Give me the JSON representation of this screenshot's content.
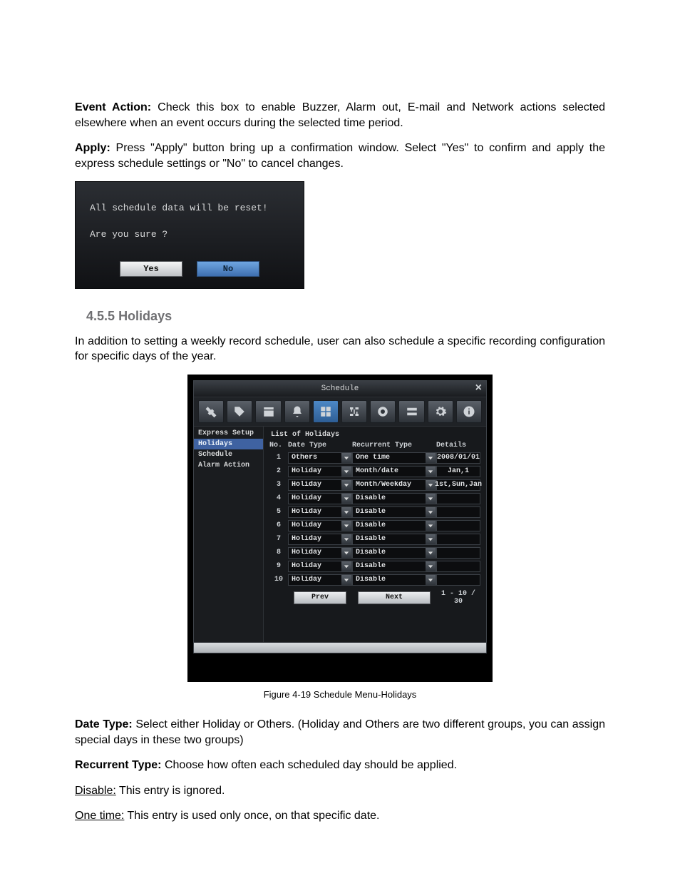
{
  "para_event_action_label": "Event Action:",
  "para_event_action_text": " Check this box to enable Buzzer, Alarm out, E-mail and Network actions selected elsewhere when an event occurs during the selected time period.",
  "para_apply_label": "Apply:",
  "para_apply_text": " Press \"Apply\" button bring up a confirmation window. Select \"Yes\" to confirm and apply the express schedule settings or \"No\" to cancel changes.",
  "confirm_dialog": {
    "line1": "All schedule data will be reset!",
    "line2": "Are you sure ?",
    "yes": "Yes",
    "no": "No"
  },
  "section_number": "4.5.5",
  "section_title": "Holidays",
  "para_holidays_intro": "In addition to setting a weekly record schedule, user can also schedule a specific recording configuration for specific days of the year.",
  "schedule_window": {
    "title": "Schedule",
    "close": "×",
    "toolbar_icons": [
      "tools-icon",
      "tag-icon",
      "calendar-icon",
      "bell-icon",
      "layout-icon",
      "network-icon",
      "camera-icon",
      "storage-icon",
      "gear-icon",
      "info-icon"
    ],
    "toolbar_selected_index": 4,
    "sidebar": {
      "items": [
        "Express Setup",
        "Holidays",
        "Schedule",
        "Alarm Action"
      ],
      "selected_index": 1
    },
    "list_title": "List of Holidays",
    "columns": {
      "no": "No.",
      "date_type": "Date Type",
      "recurrent_type": "Recurrent Type",
      "details": "Details"
    },
    "rows": [
      {
        "no": "1",
        "date_type": "Others",
        "recurrent": "One time",
        "details": "2008/01/01"
      },
      {
        "no": "2",
        "date_type": "Holiday",
        "recurrent": "Month/date",
        "details": "Jan,1"
      },
      {
        "no": "3",
        "date_type": "Holiday",
        "recurrent": "Month/Weekday",
        "details": "1st,Sun,Jan"
      },
      {
        "no": "4",
        "date_type": "Holiday",
        "recurrent": "Disable",
        "details": ""
      },
      {
        "no": "5",
        "date_type": "Holiday",
        "recurrent": "Disable",
        "details": ""
      },
      {
        "no": "6",
        "date_type": "Holiday",
        "recurrent": "Disable",
        "details": ""
      },
      {
        "no": "7",
        "date_type": "Holiday",
        "recurrent": "Disable",
        "details": ""
      },
      {
        "no": "8",
        "date_type": "Holiday",
        "recurrent": "Disable",
        "details": ""
      },
      {
        "no": "9",
        "date_type": "Holiday",
        "recurrent": "Disable",
        "details": ""
      },
      {
        "no": "10",
        "date_type": "Holiday",
        "recurrent": "Disable",
        "details": ""
      }
    ],
    "prev_label": "Prev",
    "next_label": "Next",
    "page_info": "1 - 10 / 30"
  },
  "figure_caption": "Figure 4-19 Schedule Menu-Holidays",
  "para_date_type_label": "Date Type:",
  "para_date_type_text": " Select either Holiday or Others. (Holiday and Others are two different groups, you can assign special days in these two groups)",
  "para_recurrent_label": "Recurrent Type:",
  "para_recurrent_text": " Choose how often each scheduled day should be applied.",
  "disable_term": "Disable:",
  "disable_text": " This entry is ignored.",
  "onetime_term": "One time:",
  "onetime_text": " This entry is used only once, on that specific date."
}
